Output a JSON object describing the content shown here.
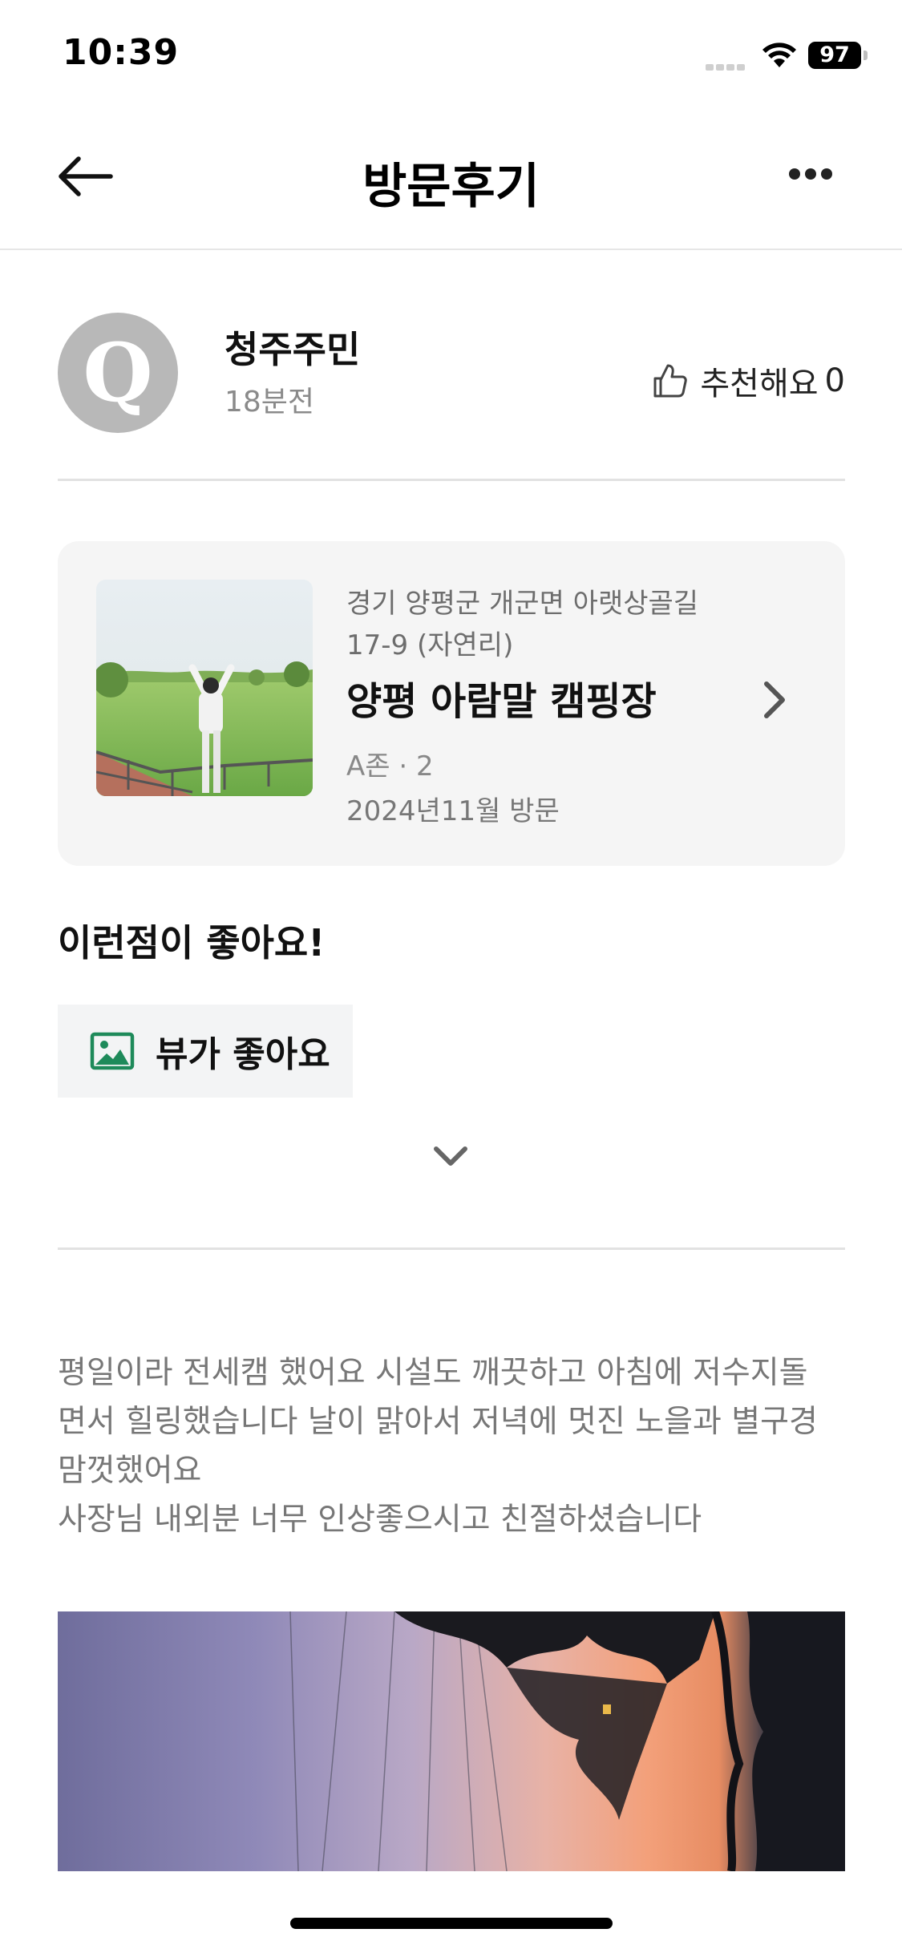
{
  "status_bar": {
    "time": "10:39",
    "battery": "97"
  },
  "nav": {
    "title": "방문후기"
  },
  "author": {
    "avatar_letter": "Q",
    "name": "청주주민",
    "time": "18분전",
    "recommend_label": "추천해요",
    "recommend_count": "0"
  },
  "place": {
    "address": "경기 양평군 개군면 아랫상골길 17-9 (자연리)",
    "name": "양평 아람말 캠핑장",
    "zone": "A존 · 2",
    "visit": "2024년11월 방문"
  },
  "good_points": {
    "heading": "이런점이 좋아요!",
    "chips": [
      {
        "label": "뷰가 좋아요",
        "icon": "image-icon"
      }
    ]
  },
  "review": {
    "lines": [
      "평일이라 전세캠 했어요 시설도 깨끗하고 아침에 저수지돌",
      "면서 힐링했습니다 날이 맑아서 저녁에 멋진 노을과 별구경",
      "맘껏했어요",
      "사장님 내외분 너무 인상좋으시고 친절하셨습니다"
    ]
  },
  "colors": {
    "accent_green": "#1e8a5a",
    "card_bg": "#f5f5f5",
    "muted_text": "#777777"
  }
}
